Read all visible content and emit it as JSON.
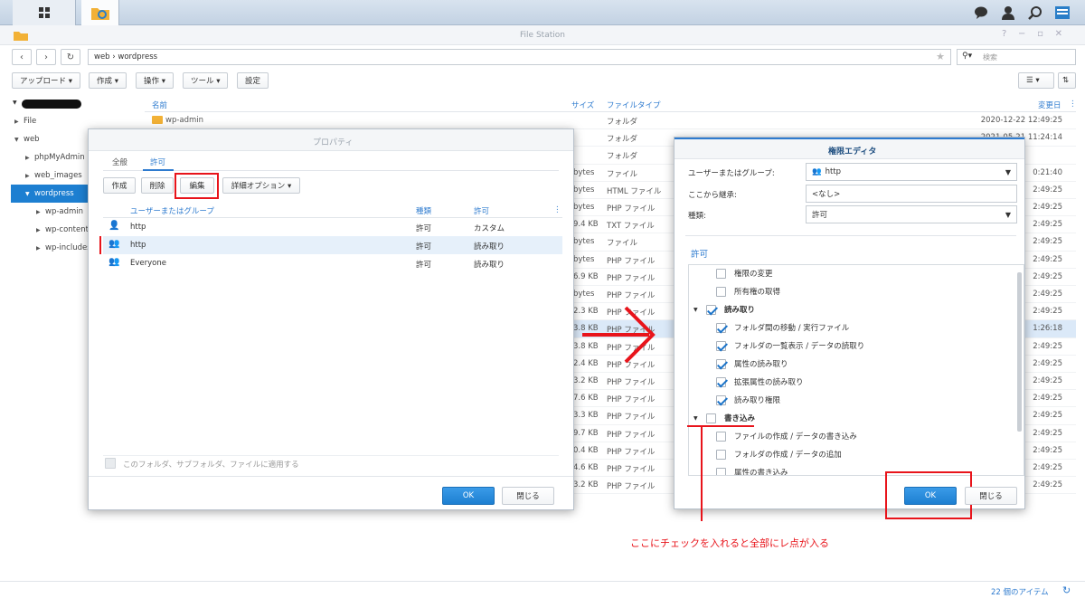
{
  "file_station": {
    "title": "File Station",
    "path": "web › wordpress",
    "search_placeholder": "検索",
    "toolbar": {
      "upload": "アップロード ▾",
      "create": "作成 ▾",
      "action": "操作 ▾",
      "tools": "ツール ▾",
      "settings": "設定"
    },
    "tree": [
      {
        "label": "File",
        "indent": 1,
        "expanded": false,
        "selected": false
      },
      {
        "label": "web",
        "indent": 1,
        "expanded": true,
        "selected": false
      },
      {
        "label": "phpMyAdmin",
        "indent": 2,
        "expanded": false,
        "selected": false
      },
      {
        "label": "web_images",
        "indent": 2,
        "expanded": false,
        "selected": false
      },
      {
        "label": "wordpress",
        "indent": 2,
        "expanded": true,
        "selected": true
      },
      {
        "label": "wp-admin",
        "indent": 3,
        "expanded": false,
        "selected": false
      },
      {
        "label": "wp-content",
        "indent": 3,
        "expanded": false,
        "selected": false
      },
      {
        "label": "wp-includes",
        "indent": 3,
        "expanded": false,
        "selected": false
      }
    ],
    "columns": {
      "name": "名前",
      "size": "サイズ",
      "type": "ファイルタイプ",
      "modified": "変更日"
    },
    "rows": [
      {
        "name": "wp-admin",
        "size": "",
        "type": "フォルダ",
        "modified": "2020-12-22 12:49:25"
      },
      {
        "name": "",
        "size": "",
        "type": "フォルダ",
        "modified": "2021-05-21 11:24:14"
      },
      {
        "name": "",
        "size": "",
        "type": "フォルダ",
        "modified": ""
      },
      {
        "name": "",
        "size": "bytes",
        "type": "ファイル",
        "modified": "0:21:40"
      },
      {
        "name": "",
        "size": "bytes",
        "type": "HTML ファイル",
        "modified": "2:49:25"
      },
      {
        "name": "",
        "size": "bytes",
        "type": "PHP ファイル",
        "modified": "2:49:25"
      },
      {
        "name": "",
        "size": "9.4 KB",
        "type": "TXT ファイル",
        "modified": "2:49:25"
      },
      {
        "name": "",
        "size": "bytes",
        "type": "ファイル",
        "modified": "2:49:25"
      },
      {
        "name": "",
        "size": "bytes",
        "type": "PHP ファイル",
        "modified": "2:49:25"
      },
      {
        "name": "",
        "size": "6.9 KB",
        "type": "PHP ファイル",
        "modified": "2:49:25"
      },
      {
        "name": "",
        "size": "bytes",
        "type": "PHP ファイル",
        "modified": "2:49:25"
      },
      {
        "name": "",
        "size": "2.3 KB",
        "type": "PHP ファイル",
        "modified": "2:49:25"
      },
      {
        "name": "",
        "size": "3.8 KB",
        "type": "PHP ファイル",
        "modified": "1:26:18"
      },
      {
        "name": "",
        "size": "3.8 KB",
        "type": "PHP ファイル",
        "modified": "2:49:25"
      },
      {
        "name": "",
        "size": "2.4 KB",
        "type": "PHP ファイル",
        "modified": "2:49:25"
      },
      {
        "name": "",
        "size": "3.2 KB",
        "type": "PHP ファイル",
        "modified": "2:49:25"
      },
      {
        "name": "",
        "size": "7.6 KB",
        "type": "PHP ファイル",
        "modified": "2:49:25"
      },
      {
        "name": "",
        "size": "3.3 KB",
        "type": "PHP ファイル",
        "modified": "2:49:25"
      },
      {
        "name": "",
        "size": "9.7 KB",
        "type": "PHP ファイル",
        "modified": "2:49:25"
      },
      {
        "name": "",
        "size": "0.4 KB",
        "type": "PHP ファイル",
        "modified": "2:49:25"
      },
      {
        "name": "",
        "size": "4.6 KB",
        "type": "PHP ファイル",
        "modified": "2:49:25"
      },
      {
        "name": "",
        "size": "3.2 KB",
        "type": "PHP ファイル",
        "modified": "2:49:25"
      }
    ],
    "item_count": "22 個のアイテム"
  },
  "properties": {
    "title": "プロパティ",
    "tabs": [
      "全般",
      "許可"
    ],
    "buttons": {
      "create": "作成",
      "delete": "削除",
      "edit": "編集",
      "advanced": "詳細オプション ▾"
    },
    "columns": {
      "user": "ユーザーまたはグループ",
      "kind": "種類",
      "perm": "許可"
    },
    "rows": [
      {
        "user": "http",
        "kind": "許可",
        "perm": "カスタム"
      },
      {
        "user": "http",
        "kind": "許可",
        "perm": "読み取り"
      },
      {
        "user": "Everyone",
        "kind": "許可",
        "perm": "読み取り"
      }
    ],
    "apply_label": "このフォルダ、サブフォルダ、ファイルに適用する",
    "ok": "OK",
    "close": "閉じる"
  },
  "permission_editor": {
    "title": "権限エディタ",
    "user_label": "ユーザーまたはグループ:",
    "user_value": "http",
    "inherit_label": "ここから継承:",
    "inherit_value": "<なし>",
    "type_label": "種類:",
    "type_value": "許可",
    "section": "許可",
    "items": [
      {
        "label": "権限の変更",
        "checked": false,
        "group": false
      },
      {
        "label": "所有権の取得",
        "checked": false,
        "group": false
      },
      {
        "label": "読み取り",
        "checked": true,
        "group": true
      },
      {
        "label": "フォルダ間の移動 / 実行ファイル",
        "checked": true,
        "group": false
      },
      {
        "label": "フォルダの一覧表示 / データの読取り",
        "checked": true,
        "group": false
      },
      {
        "label": "属性の読み取り",
        "checked": true,
        "group": false
      },
      {
        "label": "拡張属性の読み取り",
        "checked": true,
        "group": false
      },
      {
        "label": "読み取り権限",
        "checked": true,
        "group": false
      },
      {
        "label": "書き込み",
        "checked": false,
        "group": true
      },
      {
        "label": "ファイルの作成 / データの書き込み",
        "checked": false,
        "group": false
      },
      {
        "label": "フォルダの作成 / データの追加",
        "checked": false,
        "group": false
      },
      {
        "label": "属性の書き込み",
        "checked": false,
        "group": false
      }
    ],
    "ok": "OK",
    "close": "閉じる"
  },
  "annotation": {
    "text": "ここにチェックを入れると全部にレ点が入る",
    "color": "#e8141b"
  }
}
